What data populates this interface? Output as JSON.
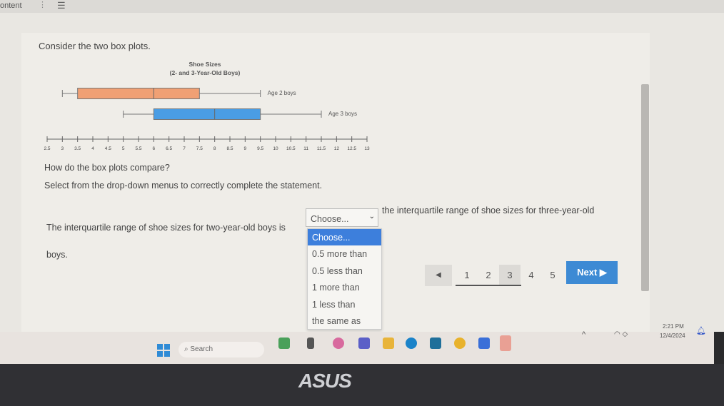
{
  "topbar": {
    "title": "ontent"
  },
  "question": {
    "intro": "Consider the two box plots.",
    "prompt": "How do the box plots compare?",
    "instruction": "Select from the drop-down menus to correctly complete the statement.",
    "statement_before": "The interquartile range of shoe sizes for two-year-old boys is",
    "statement_after": "the interquartile range of shoe sizes for three-year-old",
    "statement_end": "boys."
  },
  "dropdown": {
    "selected": "Choose...",
    "options": [
      "Choose...",
      "0.5 more than",
      "0.5 less than",
      "1 more than",
      "1 less than",
      "the same as"
    ]
  },
  "pager": {
    "prev": "◀",
    "pages": [
      "1",
      "2",
      "3",
      "4",
      "5"
    ],
    "current": "3",
    "next": "Next ▶"
  },
  "taskbar": {
    "search_placeholder": "Search",
    "time": "2:21 PM",
    "date": "12/4/2024",
    "icons": [
      "start",
      "search",
      "app",
      "file-explorer",
      "copilot",
      "teams",
      "folder",
      "edge",
      "store",
      "chrome",
      "app-2",
      "calculator"
    ]
  },
  "bezel": {
    "logo": "ASUS"
  },
  "chart_data": {
    "type": "boxplot",
    "title": "Shoe Sizes",
    "subtitle": "(2- and 3-Year-Old Boys)",
    "xlim": [
      2.5,
      13
    ],
    "ticks": [
      "2.5",
      "3",
      "3.5",
      "4",
      "4.5",
      "5",
      "5.5",
      "6",
      "6.5",
      "7",
      "7.5",
      "8",
      "8.5",
      "9",
      "9.5",
      "10",
      "10.5",
      "11",
      "11.5",
      "12",
      "12.5",
      "13"
    ],
    "series": [
      {
        "name": "Age 2 boys",
        "min": 3,
        "q1": 3.5,
        "median": 6,
        "q3": 7.5,
        "max": 9.5,
        "color": "#f0a074"
      },
      {
        "name": "Age 3 boys",
        "min": 5,
        "q1": 6,
        "median": 8,
        "q3": 9.5,
        "max": 11.5,
        "color": "#4a9de4"
      }
    ]
  }
}
